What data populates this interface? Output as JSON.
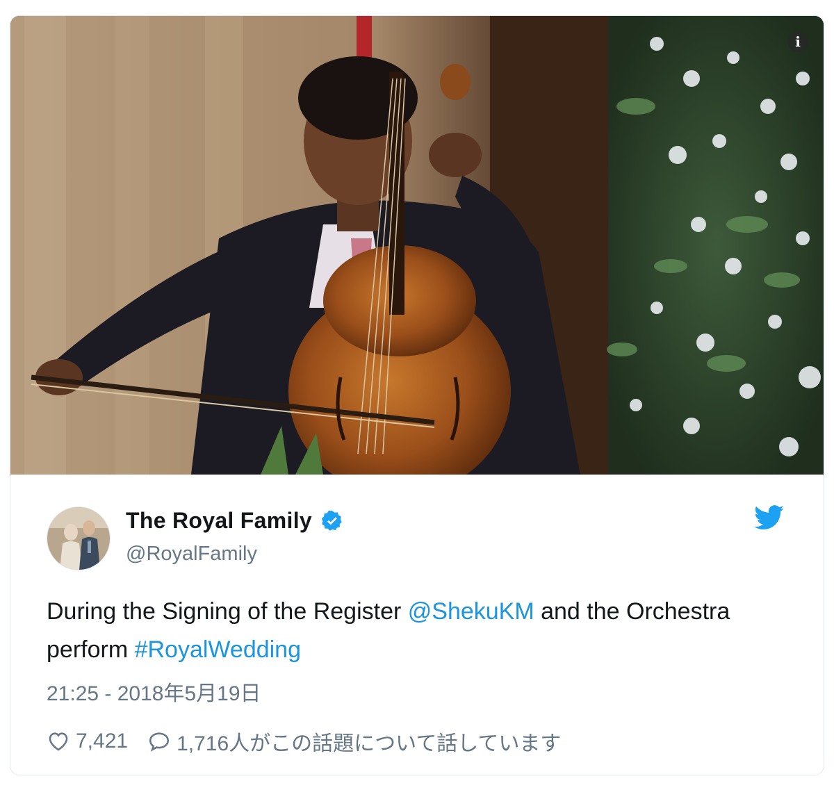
{
  "media": {
    "info_icon": "i"
  },
  "author": {
    "display_name": "The Royal Family",
    "handle": "@RoyalFamily",
    "verified": true
  },
  "tweet": {
    "text_1": "During the Signing of the Register ",
    "mention": "@ShekuKM",
    "text_2": " and the Orchestra perform ",
    "hashtag": "#RoyalWedding",
    "timestamp": "21:25 - 2018年5月19日"
  },
  "actions": {
    "likes": "7,421",
    "replies": "1,716人がこの話題について話しています"
  },
  "icons": {
    "verified": "verified-badge-icon",
    "brand": "twitter-bird-icon",
    "like": "heart-icon",
    "reply": "speech-bubble-icon",
    "info": "info-icon"
  },
  "colors": {
    "link": "#1b95e0",
    "secondary_text": "#657786",
    "border": "#e1e8ed",
    "twitter_blue": "#1da1f2"
  }
}
